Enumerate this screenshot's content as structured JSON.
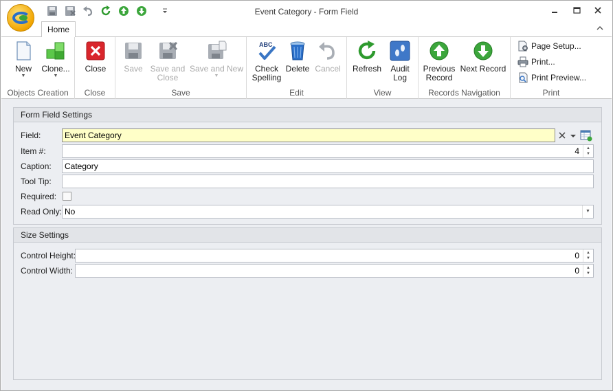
{
  "window": {
    "title": "Event Category - Form Field",
    "tabs": [
      "Home"
    ]
  },
  "ribbon": {
    "groups": [
      {
        "label": "Objects Creation",
        "buttons": [
          {
            "label": "New",
            "icon": "new-document-icon",
            "has_dropdown": true
          },
          {
            "label": "Clone...",
            "icon": "clone-cubes-icon",
            "has_dropdown": true
          }
        ]
      },
      {
        "label": "Close",
        "buttons": [
          {
            "label": "Close",
            "icon": "close-red-x-icon"
          }
        ]
      },
      {
        "label": "Save",
        "buttons": [
          {
            "label": "Save",
            "icon": "floppy-disk-icon",
            "disabled": true
          },
          {
            "label_lines": [
              "Save and",
              "Close"
            ],
            "icon": "save-close-icon",
            "disabled": true
          },
          {
            "label": "Save and New",
            "icon": "save-new-icon",
            "disabled": true,
            "has_dropdown": true
          }
        ]
      },
      {
        "label": "Edit",
        "buttons": [
          {
            "label_lines": [
              "Check",
              "Spelling"
            ],
            "icon": "abc-check-icon"
          },
          {
            "label": "Delete",
            "icon": "trash-bin-icon"
          },
          {
            "label": "Cancel",
            "icon": "undo-arrow-icon",
            "disabled": true
          }
        ]
      },
      {
        "label": "View",
        "buttons": [
          {
            "label": "Refresh",
            "icon": "refresh-icon"
          },
          {
            "label_lines": [
              "Audit",
              "Log"
            ],
            "icon": "footprints-icon"
          }
        ]
      },
      {
        "label": "Records Navigation",
        "buttons": [
          {
            "label_lines": [
              "Previous",
              "Record"
            ],
            "icon": "arrow-up-circle-icon"
          },
          {
            "label": "Next Record",
            "icon": "arrow-down-circle-icon"
          }
        ]
      },
      {
        "label": "Print",
        "buttons": [
          {
            "label": "Page Setup...",
            "icon": "page-setup-icon"
          },
          {
            "label": "Print...",
            "icon": "printer-icon"
          },
          {
            "label": "Print Preview...",
            "icon": "print-preview-icon"
          }
        ]
      }
    ]
  },
  "form_field_settings": {
    "header": "Form Field Settings",
    "field": {
      "label": "Field:",
      "value": "Event Category"
    },
    "item_number": {
      "label": "Item #:",
      "value": "4"
    },
    "caption": {
      "label": "Caption:",
      "value": "Category"
    },
    "tool_tip": {
      "label": "Tool Tip:",
      "value": ""
    },
    "required": {
      "label": "Required:",
      "checked": false
    },
    "read_only": {
      "label": "Read Only:",
      "value": "No"
    }
  },
  "size_settings": {
    "header": "Size Settings",
    "control_height": {
      "label": "Control Height:",
      "value": "0"
    },
    "control_width": {
      "label": "Control Width:",
      "value": "0"
    }
  },
  "colors": {
    "field_highlight": "#ffffc8",
    "content_background": "#eceef2",
    "close_red": "#d9262c",
    "nav_green": "#3ca63c"
  }
}
